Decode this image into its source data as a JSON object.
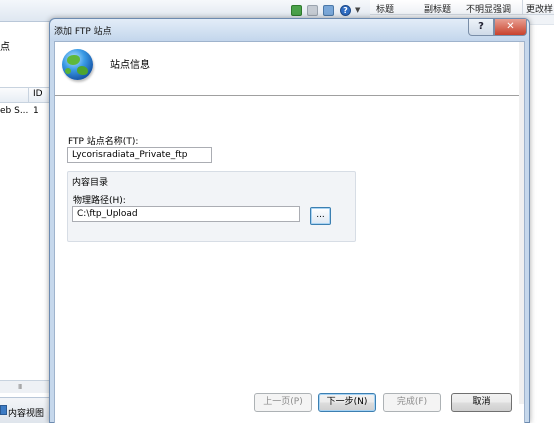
{
  "background": {
    "left_text1": "点",
    "left_col_id": "ID",
    "left_row_name": "eb S...",
    "left_row_id": "1",
    "left_scroll_grip": "III",
    "left_bottom_tab": "内容视图",
    "right_headers": [
      "标题",
      "副标题",
      "不明显强调",
      "更改样"
    ]
  },
  "dialog": {
    "title": "添加 FTP 站点",
    "help_glyph": "?",
    "close_glyph": "✕",
    "header_title": "站点信息",
    "site_name_label": "FTP 站点名称(T):",
    "site_name_value": "Lycorisradiata_Private_ftp",
    "content_dir_title": "内容目录",
    "physical_path_label": "物理路径(H):",
    "physical_path_value": "C:\\ftp_Upload",
    "browse_label": "...",
    "buttons": {
      "prev": "上一页(P)",
      "next": "下一步(N)",
      "finish": "完成(F)",
      "cancel": "取消"
    }
  }
}
